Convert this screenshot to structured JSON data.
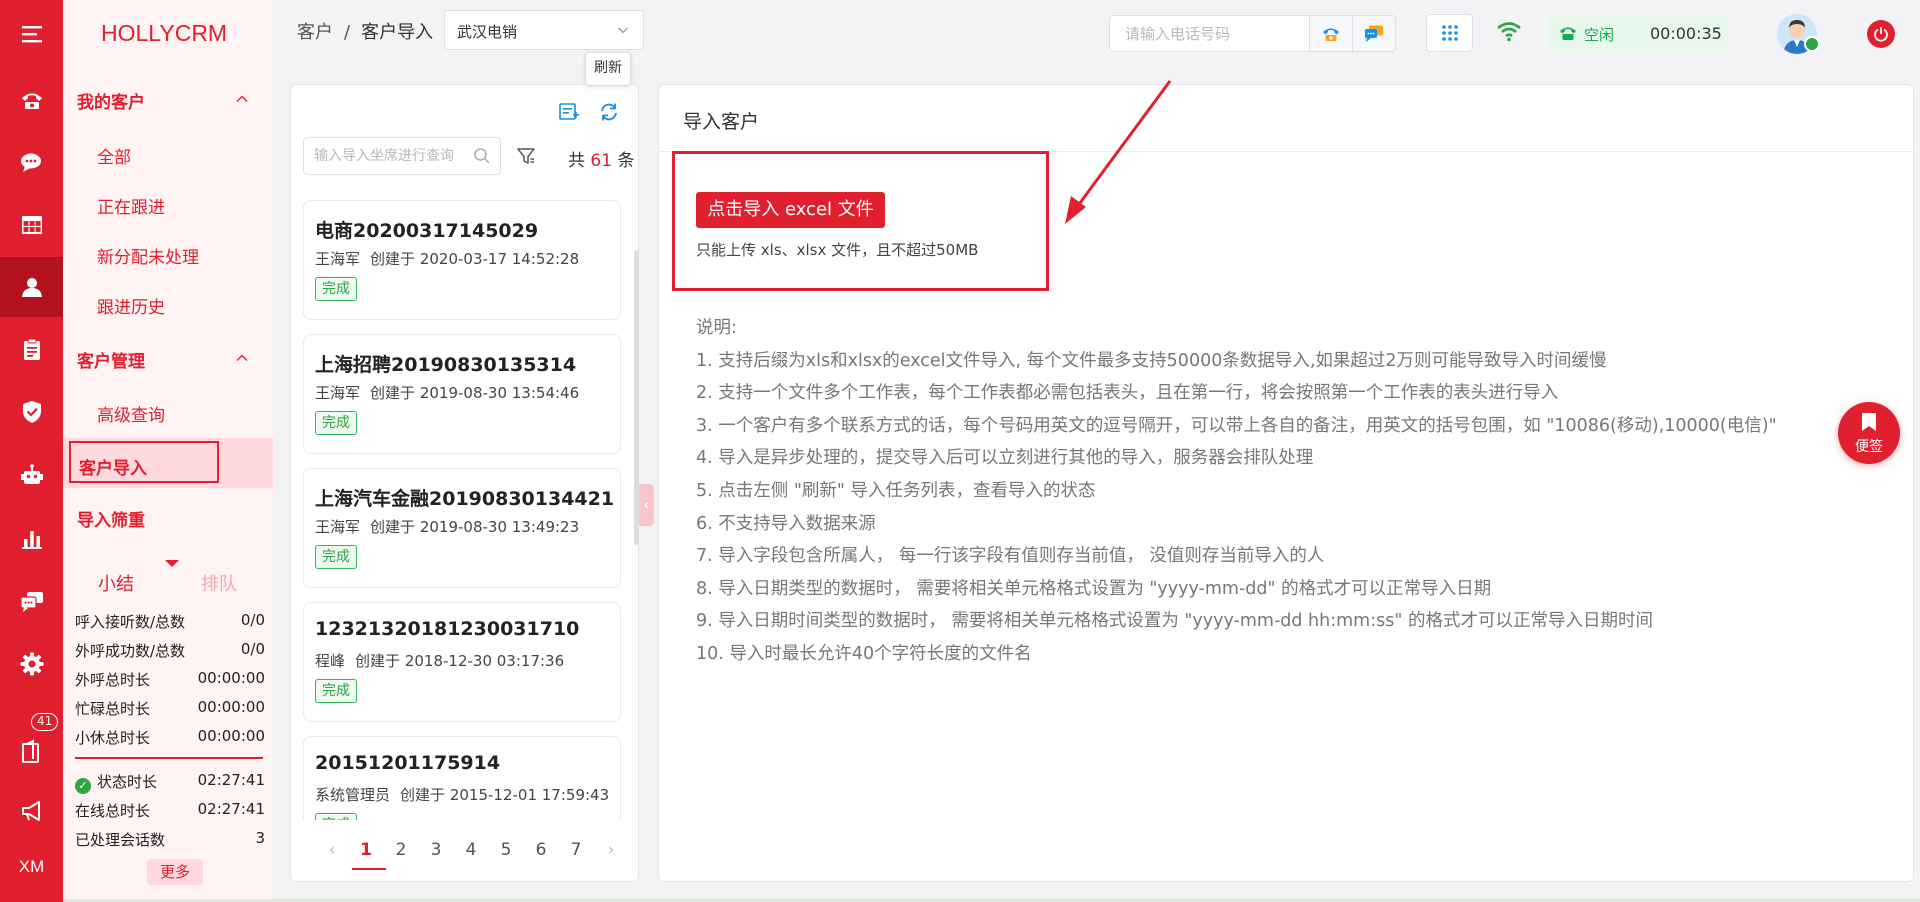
{
  "app": {
    "logo": "HOLLYCRM",
    "rail_badge": "41",
    "rail_footer": "XM"
  },
  "sidenav": {
    "group1": "我的客户",
    "group1_items": [
      "全部",
      "正在跟进",
      "新分配未处理",
      "跟进历史"
    ],
    "group2": "客户管理",
    "group2_items": [
      "高级查询",
      "客户导入"
    ],
    "group3": "导入筛重",
    "summary_tabs": [
      "小结",
      "排队"
    ],
    "stats": [
      {
        "k": "呼入接听数/总数",
        "v": "0/0"
      },
      {
        "k": "外呼成功数/总数",
        "v": "0/0"
      },
      {
        "k": "外呼总时长",
        "v": "00:00:00"
      },
      {
        "k": "忙碌总时长",
        "v": "00:00:00"
      },
      {
        "k": "小休总时长",
        "v": "00:00:00"
      },
      {
        "k": "状态时长",
        "v": "02:27:41"
      },
      {
        "k": "在线总时长",
        "v": "02:27:41"
      },
      {
        "k": "已处理会话数",
        "v": "3"
      }
    ],
    "more": "更多"
  },
  "topbar": {
    "breadcrumb": [
      "客户",
      "客户导入"
    ],
    "separator": "/",
    "select_value": "武汉电销",
    "phone_placeholder": "请输入电话号码",
    "status": "空闲",
    "timer": "00:00:35"
  },
  "list": {
    "tooltip": "刷新",
    "query_placeholder": "输入导入坐席进行查询",
    "total_prefix": "共",
    "total": "61",
    "total_suffix": "条",
    "created_prefix": "创建于",
    "items": [
      {
        "title": "电商20200317145029",
        "by": "王海军",
        "time": "2020-03-17 14:52:28",
        "status": "完成"
      },
      {
        "title": "上海招聘20190830135314",
        "by": "王海军",
        "time": "2019-08-30 13:54:46",
        "status": "完成"
      },
      {
        "title": "上海汽车金融20190830134421",
        "by": "王海军",
        "time": "2019-08-30 13:49:23",
        "status": "完成"
      },
      {
        "title": "12321320181230031710",
        "by": "程峰",
        "time": "2018-12-30 03:17:36",
        "status": "完成"
      },
      {
        "title": "20151201175914",
        "by": "系统管理员",
        "time": "2015-12-01 17:59:43",
        "status": "完成"
      }
    ],
    "pages": [
      "1",
      "2",
      "3",
      "4",
      "5",
      "6",
      "7"
    ],
    "current_page": 1
  },
  "main": {
    "title": "导入客户",
    "upload_button": "点击导入 excel 文件",
    "upload_tip": "只能上传 xls、xlsx 文件，且不超过50MB",
    "notes": [
      "说明:",
      "1. 支持后缀为xls和xlsx的excel文件导入, 每个文件最多支持50000条数据导入,如果超过2万则可能导致导入时间缓慢",
      "2. 支持一个文件多个工作表，每个工作表都必需包括表头，且在第一行，将会按照第一个工作表的表头进行导入",
      "3. 一个客户有多个联系方式的话，每个号码用英文的逗号隔开，可以带上各自的备注，用英文的括号包围，如 \"10086(移动),10000(电信)\"",
      "4. 导入是异步处理的，提交导入后可以立刻进行其他的导入，服务器会排队处理",
      "5. 点击左侧 \"刷新\" 导入任务列表，查看导入的状态",
      "6. 不支持导入数据来源",
      "7. 导入字段包含所属人， 每一行该字段有值则存当前值， 没值则存当前导入的人",
      "8. 导入日期类型的数据时， 需要将相关单元格格式设置为 \"yyyy-mm-dd\" 的格式才可以正常导入日期",
      "9. 导入日期时间类型的数据时， 需要将相关单元格格式设置为 \"yyyy-mm-dd hh:mm:ss\" 的格式才可以正常导入日期时间",
      "10. 导入时最长允许40个字符长度的文件名"
    ],
    "memo": "便签"
  },
  "colors": {
    "brand": "#e0202f",
    "success": "#2ea442",
    "status_bg": "#e8f7ec"
  },
  "icons": {
    "rail": [
      "menu-icon",
      "phone-icon",
      "chat-icon",
      "table-icon",
      "user-icon",
      "clipboard-icon",
      "shield-icon",
      "robot-icon",
      "bar-chart-icon",
      "message-icon",
      "settings-icon",
      "book-icon",
      "megaphone-icon"
    ]
  }
}
